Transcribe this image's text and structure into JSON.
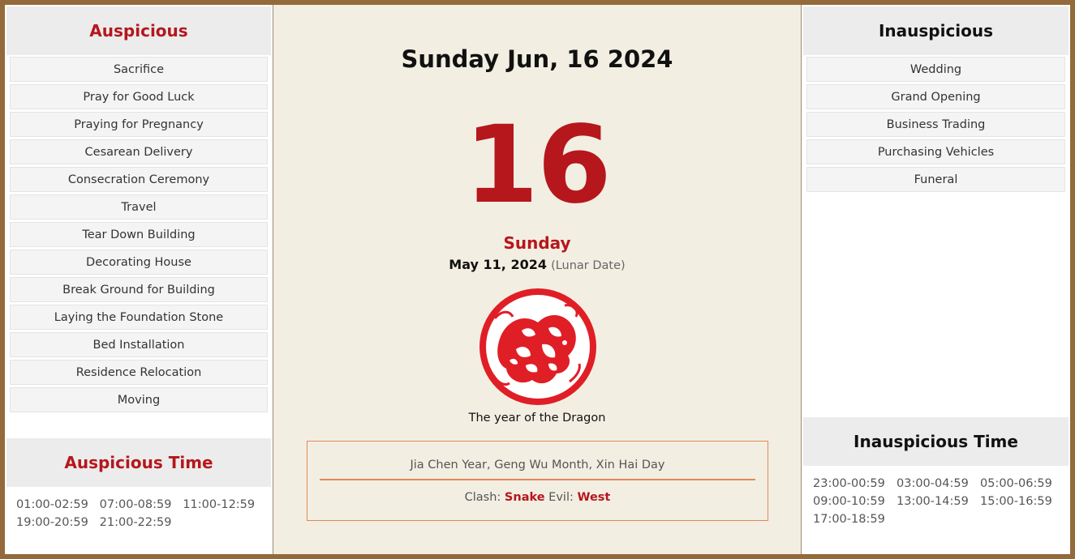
{
  "auspicious": {
    "title": "Auspicious",
    "items": [
      "Sacrifice",
      "Pray for Good Luck",
      "Praying for Pregnancy",
      "Cesarean Delivery",
      "Consecration Ceremony",
      "Travel",
      "Tear Down Building",
      "Decorating House",
      "Break Ground for Building",
      "Laying the Foundation Stone",
      "Bed Installation",
      "Residence Relocation",
      "Moving"
    ]
  },
  "auspicious_time": {
    "title": "Auspicious Time",
    "times": [
      "01:00-02:59",
      "07:00-08:59",
      "11:00-12:59",
      "19:00-20:59",
      "21:00-22:59"
    ]
  },
  "main": {
    "title": "Sunday Jun, 16 2024",
    "day_number": "16",
    "weekday": "Sunday",
    "lunar_date": "May 11, 2024",
    "lunar_note": "(Lunar Date)",
    "zodiac_icon": "dragon-papercut-icon",
    "zodiac_caption": "The year of the Dragon",
    "ganzhi": "Jia Chen Year, Geng Wu Month, Xin Hai Day",
    "clash_label": "Clash:",
    "clash_value": "Snake",
    "evil_label": "Evil:",
    "evil_value": "West"
  },
  "inauspicious": {
    "title": "Inauspicious",
    "items": [
      "Wedding",
      "Grand Opening",
      "Business Trading",
      "Purchasing Vehicles",
      "Funeral"
    ]
  },
  "inauspicious_time": {
    "title": "Inauspicious Time",
    "times": [
      "23:00-00:59",
      "03:00-04:59",
      "05:00-06:59",
      "09:00-10:59",
      "13:00-14:59",
      "15:00-16:59",
      "17:00-18:59"
    ]
  },
  "colors": {
    "accent_red": "#b5171d",
    "frame_brown": "#946a3a",
    "box_orange": "#e08a58"
  }
}
